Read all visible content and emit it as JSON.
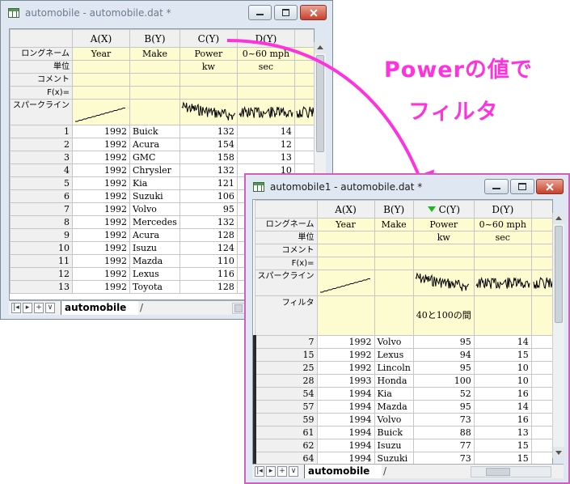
{
  "window1": {
    "title": "automobile - automobile.dat *",
    "columns": [
      "A(X)",
      "B(Y)",
      "C(Y)",
      "D(Y)"
    ],
    "meta_rows": [
      {
        "label": "ロングネーム",
        "values": [
          "Year",
          "Make",
          "Power",
          "0~60 mph"
        ]
      },
      {
        "label": "単位",
        "values": [
          "",
          "",
          "kw",
          "sec"
        ]
      },
      {
        "label": "コメント",
        "values": [
          "",
          "",
          "",
          ""
        ]
      },
      {
        "label": "F(x)=",
        "values": [
          "",
          "",
          "",
          ""
        ]
      }
    ],
    "sparkline_label": "スパークライン",
    "rows": [
      {
        "idx": "1",
        "year": "1992",
        "make": "Buick",
        "power": "132",
        "sec": "14"
      },
      {
        "idx": "2",
        "year": "1992",
        "make": "Acura",
        "power": "154",
        "sec": "12"
      },
      {
        "idx": "3",
        "year": "1992",
        "make": "GMC",
        "power": "158",
        "sec": "13"
      },
      {
        "idx": "4",
        "year": "1992",
        "make": "Chrysler",
        "power": "132",
        "sec": "10"
      },
      {
        "idx": "5",
        "year": "1992",
        "make": "Kia",
        "power": "121",
        "sec": "14"
      },
      {
        "idx": "6",
        "year": "1992",
        "make": "Suzuki",
        "power": "106",
        "sec": "12"
      },
      {
        "idx": "7",
        "year": "1992",
        "make": "Volvo",
        "power": "95",
        "sec": "14"
      },
      {
        "idx": "8",
        "year": "1992",
        "make": "Mercedes",
        "power": "132",
        "sec": "13"
      },
      {
        "idx": "9",
        "year": "1992",
        "make": "Acura",
        "power": "128",
        "sec": "12"
      },
      {
        "idx": "10",
        "year": "1992",
        "make": "Isuzu",
        "power": "124",
        "sec": "12"
      },
      {
        "idx": "11",
        "year": "1992",
        "make": "Mazda",
        "power": "110",
        "sec": "12"
      },
      {
        "idx": "12",
        "year": "1992",
        "make": "Lexus",
        "power": "116",
        "sec": "11"
      },
      {
        "idx": "13",
        "year": "1992",
        "make": "Toyota",
        "power": "128",
        "sec": "12"
      }
    ],
    "sheet_tab": "automobile"
  },
  "window2": {
    "title": "automobile1 - automobile.dat *",
    "columns": [
      "A(X)",
      "B(Y)",
      "C(Y)",
      "D(Y)"
    ],
    "meta_rows": [
      {
        "label": "ロングネーム",
        "values": [
          "Year",
          "Make",
          "Power",
          "0~60 mph"
        ]
      },
      {
        "label": "単位",
        "values": [
          "",
          "",
          "kw",
          "sec"
        ]
      },
      {
        "label": "コメント",
        "values": [
          "",
          "",
          "",
          ""
        ]
      },
      {
        "label": "F(x)=",
        "values": [
          "",
          "",
          "",
          ""
        ]
      }
    ],
    "sparkline_label": "スパークライン",
    "filter_label": "フィルタ",
    "filter_condition": "40と100の間",
    "rows": [
      {
        "idx": "7",
        "year": "1992",
        "make": "Volvo",
        "power": "95",
        "sec": "14"
      },
      {
        "idx": "15",
        "year": "1992",
        "make": "Lexus",
        "power": "94",
        "sec": "15"
      },
      {
        "idx": "25",
        "year": "1992",
        "make": "Lincoln",
        "power": "95",
        "sec": "10"
      },
      {
        "idx": "28",
        "year": "1993",
        "make": "Honda",
        "power": "100",
        "sec": "10"
      },
      {
        "idx": "54",
        "year": "1994",
        "make": "Kia",
        "power": "52",
        "sec": "16"
      },
      {
        "idx": "57",
        "year": "1994",
        "make": "Mazda",
        "power": "95",
        "sec": "14"
      },
      {
        "idx": "59",
        "year": "1994",
        "make": "Volvo",
        "power": "73",
        "sec": "16"
      },
      {
        "idx": "61",
        "year": "1994",
        "make": "Buick",
        "power": "88",
        "sec": "13"
      },
      {
        "idx": "62",
        "year": "1994",
        "make": "Isuzu",
        "power": "77",
        "sec": "15"
      },
      {
        "idx": "64",
        "year": "1994",
        "make": "Suzuki",
        "power": "73",
        "sec": "15"
      }
    ],
    "sheet_tab": "automobile"
  },
  "annotation": {
    "line1": "Powerの値で",
    "line2": "フィルタ",
    "color": "#ff33dd"
  },
  "colors": {
    "meta_bg": "#fcfcd0",
    "header_bg": "#f0f0f0",
    "window_border": "#d060c0",
    "filter_icon": "#1fb81f"
  }
}
